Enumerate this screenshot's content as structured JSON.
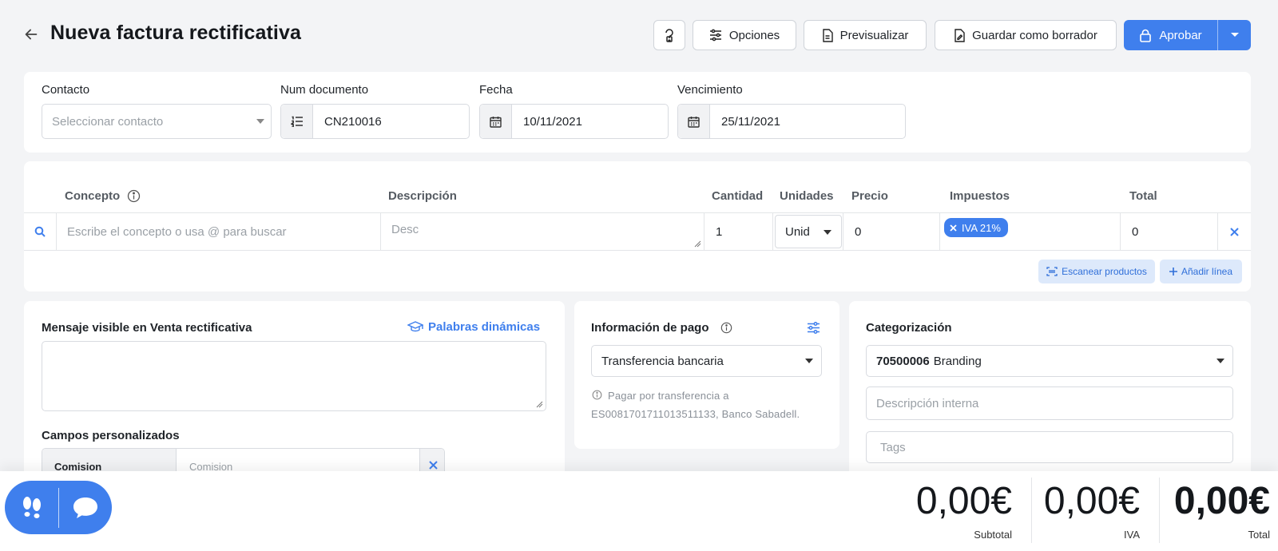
{
  "header": {
    "title": "Nueva factura rectificativa",
    "options_label": "Opciones",
    "preview_label": "Previsualizar",
    "draft_label": "Guardar como borrador",
    "approve_label": "Aprobar"
  },
  "form": {
    "contact": {
      "label": "Contacto",
      "placeholder": "Seleccionar contacto"
    },
    "doc_number": {
      "label": "Num documento",
      "value": "CN210016"
    },
    "date": {
      "label": "Fecha",
      "value": "10/11/2021"
    },
    "due": {
      "label": "Vencimiento",
      "value": "25/11/2021"
    }
  },
  "lines": {
    "headers": {
      "concept": "Concepto",
      "description": "Descripción",
      "quantity": "Cantidad",
      "units": "Unidades",
      "price": "Precio",
      "taxes": "Impuestos",
      "total": "Total"
    },
    "row": {
      "concept_placeholder": "Escribe el concepto o usa @ para buscar",
      "description_placeholder": "Desc",
      "quantity": "1",
      "unit": "Unid",
      "price": "0",
      "tax": "IVA 21%",
      "total": "0"
    },
    "scan_label": "Escanear productos",
    "add_line_label": "Añadir línea"
  },
  "message": {
    "title": "Mensaje visible en Venta rectificativa",
    "dynamic_words": "Palabras dinámicas",
    "custom_fields_title": "Campos personalizados",
    "field_name": "Comision",
    "field_placeholder": "Comision"
  },
  "payment": {
    "title": "Información de pago",
    "method": "Transferencia bancaria",
    "note_line1": "Pagar por transferencia a",
    "note_line2": "ES0081701711013511133, Banco Sabadell."
  },
  "category": {
    "title": "Categorización",
    "account_code": "70500006",
    "account_name": "Branding",
    "internal_desc_placeholder": "Descripción interna",
    "tags_placeholder": "Tags"
  },
  "totals": {
    "subtotal": "0,00€",
    "subtotal_label": "Subtotal",
    "iva": "0,00€",
    "iva_label": "IVA",
    "total": "0,00€",
    "total_label": "Total"
  },
  "colors": {
    "accent": "#3f7fed"
  }
}
